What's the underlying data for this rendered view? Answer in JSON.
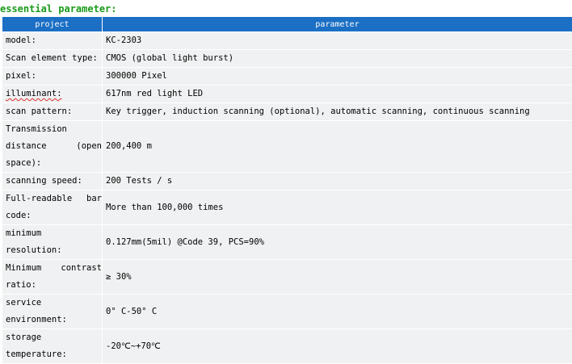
{
  "heading": "essential parameter:",
  "table": {
    "header": {
      "project": "project",
      "parameter": "parameter"
    },
    "rows": [
      {
        "key": "model:",
        "value": "KC-2303"
      },
      {
        "key": "Scan element type:",
        "value": "CMOS (global light burst)"
      },
      {
        "key": "pixel:",
        "value": "300000 Pixel"
      },
      {
        "key": "illuminant:",
        "value": "617nm red light LED"
      },
      {
        "key": "scan pattern:",
        "value": "Key trigger, induction scanning (optional), automatic scanning, continuous scanning"
      },
      {
        "key": "Transmission distance (open space):",
        "value": "200,400 m"
      },
      {
        "key": "scanning speed:",
        "value": "200 Tests / s"
      },
      {
        "key": "Full-readable bar code:",
        "value": "More than 100,000 times"
      },
      {
        "key": "minimum resolution:",
        "value": "0.127mm(5mil) @Code 39, PCS=90%"
      },
      {
        "key": "Minimum contrast ratio:",
        "value": "≥ 30%"
      },
      {
        "key": "service environment:",
        "value": "0° C-50° C"
      },
      {
        "key": "storage temperature:",
        "value": "-20℃~+70℃"
      }
    ]
  },
  "colors": {
    "heading": "#1a9b1a",
    "header_bg": "#1b6fc4",
    "cell_bg": "#f0f1f2"
  }
}
